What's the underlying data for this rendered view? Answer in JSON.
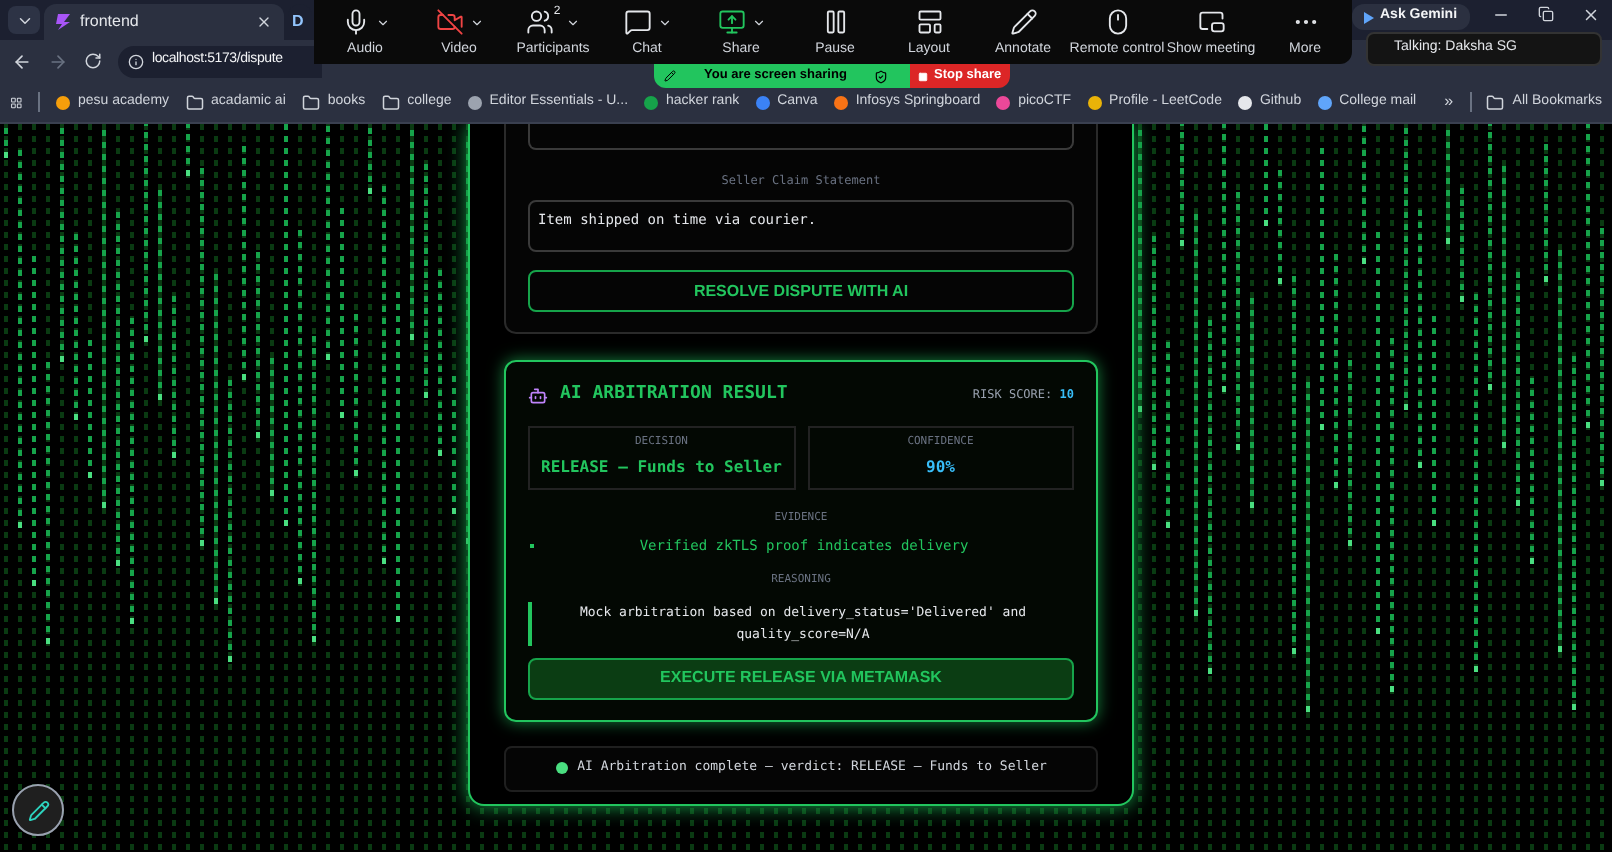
{
  "browser": {
    "tabs": [
      {
        "title": "frontend",
        "selected": true
      },
      {
        "title": "D",
        "selected": false
      }
    ],
    "address": "localhost:5173/dispute",
    "bookmarks": [
      {
        "kind": "site",
        "label": "pesu academy",
        "color": "#f59e0b"
      },
      {
        "kind": "folder",
        "label": "acadamic ai"
      },
      {
        "kind": "folder",
        "label": "books"
      },
      {
        "kind": "folder",
        "label": "college"
      },
      {
        "kind": "site",
        "label": "Editor Essentials - U...",
        "color": "#9ca3af"
      },
      {
        "kind": "site",
        "label": "hacker rank",
        "color": "#16a34a"
      },
      {
        "kind": "site",
        "label": "Canva",
        "color": "#3b82f6"
      },
      {
        "kind": "site",
        "label": "Infosys Springboard",
        "color": "#f97316"
      },
      {
        "kind": "site",
        "label": "picoCTF",
        "color": "#ec4899"
      },
      {
        "kind": "site",
        "label": "Profile - LeetCode",
        "color": "#eab308"
      },
      {
        "kind": "site",
        "label": "Github",
        "color": "#e5e7eb"
      },
      {
        "kind": "site",
        "label": "College mail",
        "color": "#60a5fa"
      }
    ],
    "overflow": "»",
    "all_bookmarks": "All Bookmarks"
  },
  "meeting_toolbar": {
    "items": [
      {
        "kind": "audio",
        "label": "Audio",
        "caret": true
      },
      {
        "kind": "video",
        "label": "Video",
        "off": true,
        "caret": true
      },
      {
        "kind": "participants",
        "label": "Participants",
        "badge": "2",
        "caret": true
      },
      {
        "kind": "chat",
        "label": "Chat",
        "caret": true
      },
      {
        "kind": "share",
        "label": "Share",
        "caret": true
      },
      {
        "kind": "pause",
        "label": "Pause"
      },
      {
        "kind": "layout",
        "label": "Layout"
      },
      {
        "kind": "annotate",
        "label": "Annotate"
      },
      {
        "kind": "remote",
        "label": "Remote control"
      },
      {
        "kind": "show",
        "label": "Show meeting"
      },
      {
        "kind": "more",
        "label": "More"
      }
    ],
    "sharing_status": "You are screen sharing",
    "stop_share": "Stop share"
  },
  "ask_gemini": "Ask Gemini",
  "talking": "Talking: Daksha SG",
  "dispute": {
    "seller_claim_label": "Seller Claim Statement",
    "seller_claim": "Item shipped on time via courier.",
    "resolve_button": "RESOLVE DISPUTE WITH AI"
  },
  "result": {
    "title": "AI ARBITRATION RESULT",
    "risk_label": "RISK SCORE:",
    "risk_value": "10",
    "decision_label": "DECISION",
    "decision": "RELEASE — Funds to Seller",
    "confidence_label": "CONFIDENCE",
    "confidence": "90%",
    "evidence_label": "EVIDENCE",
    "evidence": [
      "Verified zkTLS proof indicates delivery"
    ],
    "reasoning_label": "REASONING",
    "reasoning": "Mock arbitration based on delivery_status='Delivered' and quality_score=N/A",
    "execute_button": "EXECUTE RELEASE VIA METAMASK"
  },
  "status": "AI Arbitration complete — verdict: RELEASE — Funds to Seller"
}
